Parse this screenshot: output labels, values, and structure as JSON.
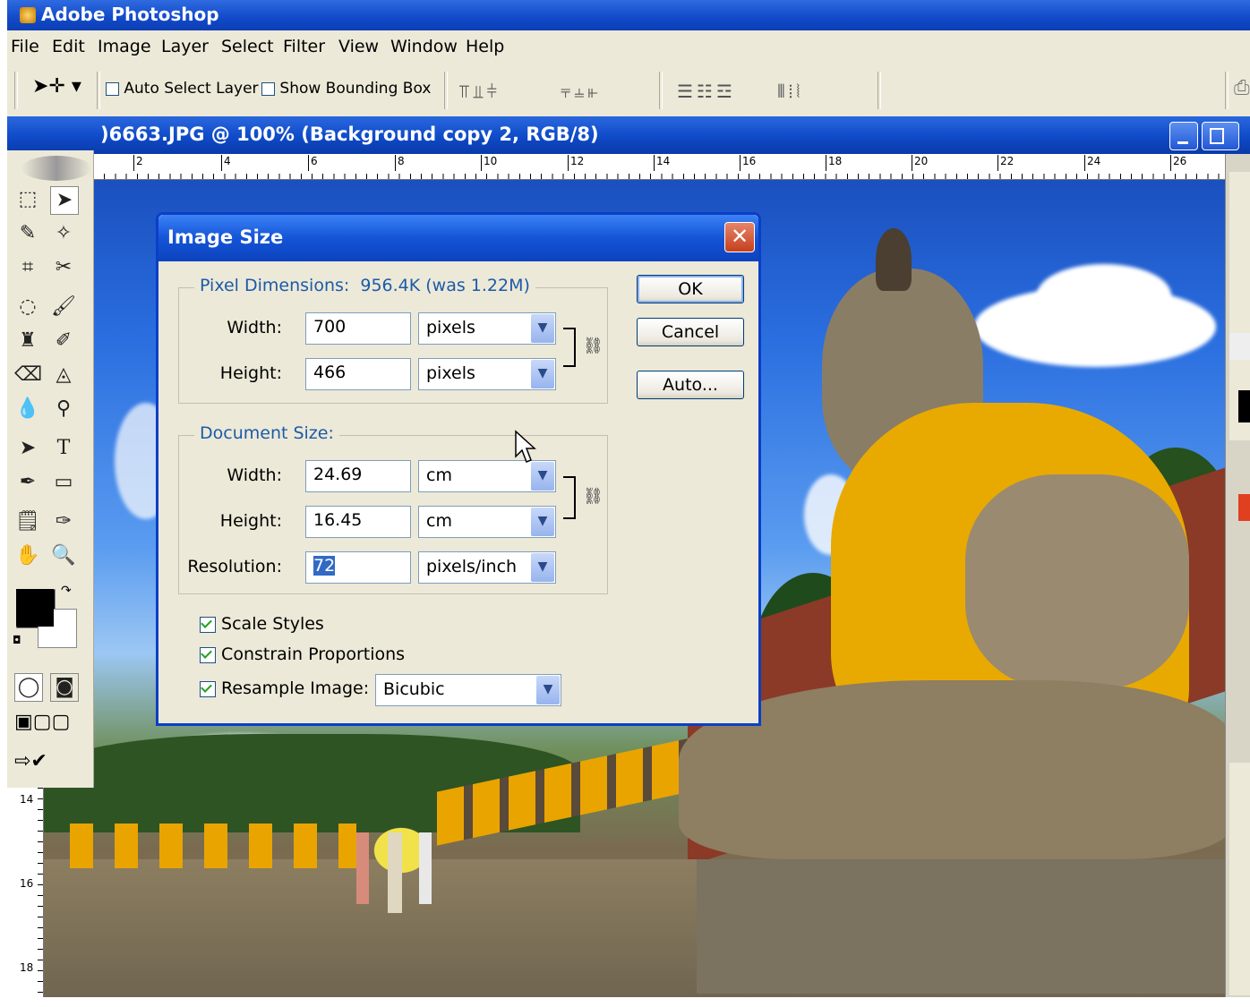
{
  "app": {
    "title": "Adobe Photoshop"
  },
  "menu": [
    "File",
    "Edit",
    "Image",
    "Layer",
    "Select",
    "Filter",
    "View",
    "Window",
    "Help"
  ],
  "options_bar": {
    "auto_select_layer": {
      "label": "Auto Select Layer",
      "checked": false
    },
    "show_bounding_box": {
      "label": "Show Bounding Box",
      "checked": false
    }
  },
  "document": {
    "title": ")6663.JPG @ 100% (Background copy 2, RGB/8)",
    "ruler_top": [
      "2",
      "4",
      "6",
      "8",
      "10",
      "12",
      "14",
      "16",
      "18",
      "20",
      "22",
      "24",
      "26"
    ],
    "ruler_left": [
      "14",
      "16",
      "18"
    ]
  },
  "dialog": {
    "title": "Image Size",
    "pixel_dimensions": {
      "legend": "Pixel Dimensions:",
      "size": "956.4K (was 1.22M)",
      "width_label": "Width:",
      "width_value": "700",
      "width_unit": "pixels",
      "height_label": "Height:",
      "height_value": "466",
      "height_unit": "pixels"
    },
    "document_size": {
      "legend": "Document Size:",
      "width_label": "Width:",
      "width_value": "24.69",
      "width_unit": "cm",
      "height_label": "Height:",
      "height_value": "16.45",
      "height_unit": "cm",
      "resolution_label": "Resolution:",
      "resolution_value": "72",
      "resolution_unit": "pixels/inch"
    },
    "scale_styles": {
      "label": "Scale Styles",
      "checked": true
    },
    "constrain_proportions": {
      "label": "Constrain Proportions",
      "checked": true
    },
    "resample_image": {
      "label": "Resample Image:",
      "checked": true,
      "method": "Bicubic"
    },
    "buttons": {
      "ok": "OK",
      "cancel": "Cancel",
      "auto": "Auto..."
    }
  },
  "colors": {
    "xp_blue": "#0b3fc6",
    "dialog_bg": "#ece9d8",
    "legend_blue": "#1c5aa8"
  }
}
